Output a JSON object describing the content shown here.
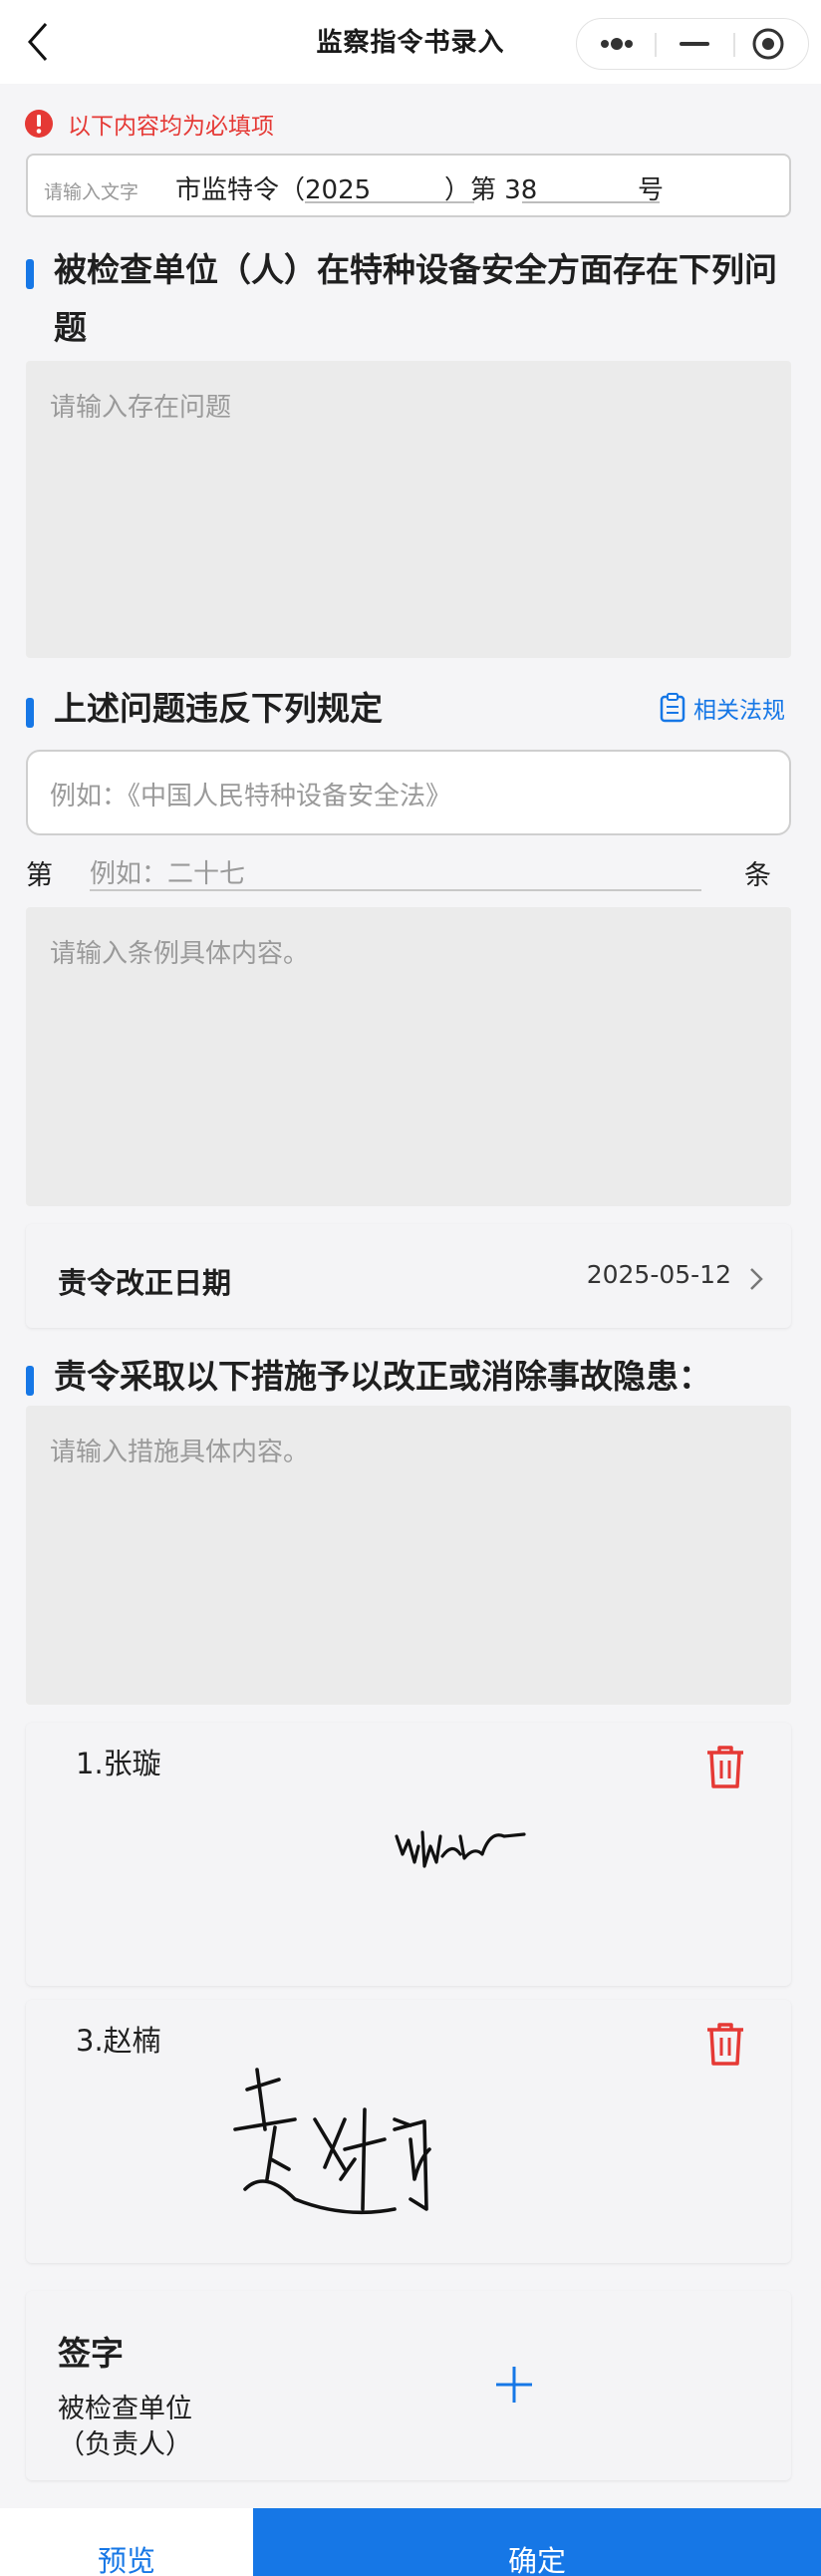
{
  "nav": {
    "title": "监察指令书录入",
    "back_icon": "chevron-left-icon",
    "capsule_icons": [
      "more-dots-icon",
      "minimize-icon",
      "target-close-icon"
    ]
  },
  "notice": {
    "icon": "error-circle-icon",
    "text": "以下内容均为必填项",
    "color": "#e53935"
  },
  "doc_number": {
    "placeholder": "请输入文字",
    "prefix": "市监特令（2025",
    "mid": "）第 38",
    "suffix": "号"
  },
  "section_problems": {
    "title": "被检查单位（人）在特种设备安全方面存在下列问题",
    "placeholder": "请输入存在问题"
  },
  "section_regulations": {
    "title": "上述问题违反下列规定",
    "link_icon": "clipboard-icon",
    "link_label": "相关法规",
    "law_placeholder": "例如：《中国人民特种设备安全法》",
    "article_prefix": "第",
    "article_placeholder": "例如：二十七",
    "article_suffix": "条",
    "content_placeholder": "请输入条例具体内容。"
  },
  "correction_date": {
    "label": "责令改正日期",
    "value": "2025-05-12",
    "chevron_icon": "chevron-right-icon"
  },
  "section_measures": {
    "title": "责令采取以下措施予以改正或消除事故隐患：",
    "placeholder": "请输入措施具体内容。"
  },
  "signers": [
    {
      "name": "1.张璇",
      "delete_icon": "trash-icon"
    },
    {
      "name": "3.赵楠",
      "delete_icon": "trash-icon"
    }
  ],
  "sign_section": {
    "title": "签字",
    "subtitle_line1": "被检查单位",
    "subtitle_line2": "（负责人）",
    "add_icon": "plus-icon"
  },
  "bottom": {
    "preview_label": "预览",
    "confirm_label": "确定"
  },
  "colors": {
    "accent": "#1677e6",
    "danger": "#e53935",
    "placeholder": "#9a9a9a"
  }
}
